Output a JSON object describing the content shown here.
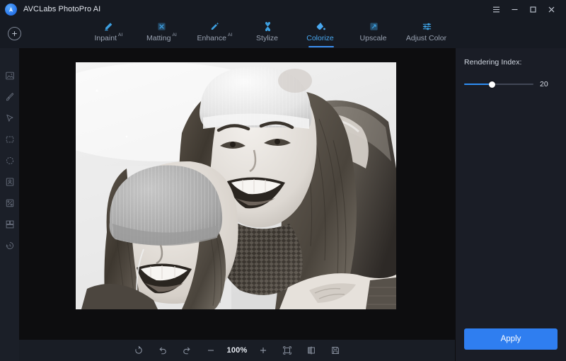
{
  "window": {
    "app_title": "AVCLabs PhotoPro AI",
    "logo_icon": "avclabs-logo-icon",
    "controls": [
      {
        "name": "menu-button",
        "icon": "hamburger-menu-icon"
      },
      {
        "name": "minimize-button",
        "icon": "minimize-icon"
      },
      {
        "name": "maximize-button",
        "icon": "maximize-icon"
      },
      {
        "name": "close-button",
        "icon": "close-icon"
      }
    ]
  },
  "toolbar": {
    "add_button": {
      "label": "",
      "icon": "plus-circle-icon"
    },
    "tabs": [
      {
        "label": "Inpaint",
        "badge": "AI",
        "icon": "inpaint-icon",
        "active": false
      },
      {
        "label": "Matting",
        "badge": "AI",
        "icon": "matting-icon",
        "active": false
      },
      {
        "label": "Enhance",
        "badge": "AI",
        "icon": "enhance-icon",
        "active": false
      },
      {
        "label": "Stylize",
        "badge": "",
        "icon": "stylize-icon",
        "active": false
      },
      {
        "label": "Colorize",
        "badge": "",
        "icon": "colorize-icon",
        "active": true
      },
      {
        "label": "Upscale",
        "badge": "",
        "icon": "upscale-icon",
        "active": false
      },
      {
        "label": "Adjust Color",
        "badge": "",
        "icon": "adjust-color-icon",
        "active": false
      }
    ]
  },
  "left_rail": {
    "tools": [
      {
        "name": "crop-tool",
        "icon": "crop-image-icon"
      },
      {
        "name": "brush-tool",
        "icon": "brush-icon"
      },
      {
        "name": "select-tool",
        "icon": "cursor-arrow-icon"
      },
      {
        "name": "rectangle-tool",
        "icon": "rectangle-marquee-icon"
      },
      {
        "name": "ellipse-tool",
        "icon": "ellipse-marquee-icon"
      },
      {
        "name": "portrait-tool",
        "icon": "portrait-icon"
      },
      {
        "name": "effects-tool",
        "icon": "effects-icon"
      },
      {
        "name": "layers-tool",
        "icon": "layers-icon"
      },
      {
        "name": "history-tool",
        "icon": "history-clock-icon"
      }
    ]
  },
  "canvas": {
    "image_alt": "black and white photo of two smiling women wearing winter knit hats"
  },
  "bottom_bar": {
    "zoom_value": "100%",
    "buttons": [
      {
        "name": "reset-button",
        "icon": "reset-circle-icon"
      },
      {
        "name": "undo-button",
        "icon": "undo-arrow-icon"
      },
      {
        "name": "redo-button",
        "icon": "redo-arrow-icon"
      },
      {
        "name": "zoom-out-button",
        "icon": "minus-icon"
      },
      {
        "name": "zoom-in-button",
        "icon": "plus-icon"
      },
      {
        "name": "fit-screen-button",
        "icon": "fit-frame-icon"
      },
      {
        "name": "compare-button",
        "icon": "compare-split-icon"
      },
      {
        "name": "save-button",
        "icon": "floppy-save-icon"
      }
    ]
  },
  "panel": {
    "rendering_index_label": "Rendering Index:",
    "rendering_index_value": "20",
    "apply_label": "Apply"
  },
  "colors": {
    "accent": "#2f7ef0",
    "tab_active": "#49a8f0",
    "titlebar_bg": "#161a22",
    "panel_bg": "#1a1d26",
    "canvas_bg": "#0d0d0f",
    "rail_bg": "#1b1f28"
  }
}
